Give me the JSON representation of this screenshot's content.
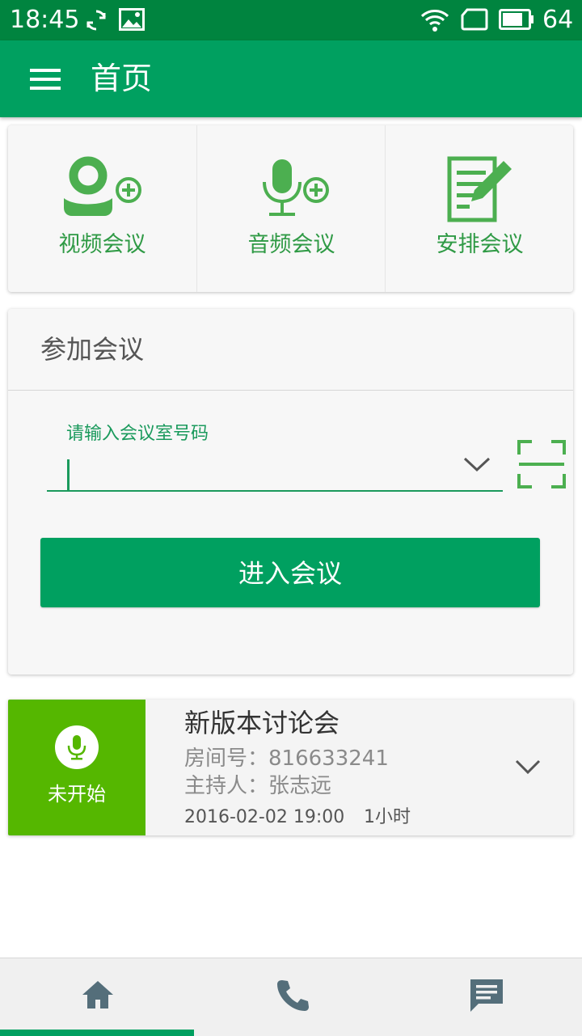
{
  "status_bar": {
    "time": "18:45",
    "battery": "64",
    "icons": [
      "sync-icon",
      "image-icon",
      "wifi-icon",
      "sim-icon",
      "battery-icon"
    ]
  },
  "app_bar": {
    "title": "首页",
    "menu_icon": "menu-icon"
  },
  "quick_actions": [
    {
      "label": "视频会议",
      "icon": "video-conference-add-icon"
    },
    {
      "label": "音频会议",
      "icon": "audio-conference-add-icon"
    },
    {
      "label": "安排会议",
      "icon": "schedule-edit-icon"
    }
  ],
  "join": {
    "heading": "参加会议",
    "input_label": "请输入会议室号码",
    "input_value": "",
    "button_label": "进入会议"
  },
  "meeting": {
    "status": "未开始",
    "title": "新版本讨论会",
    "room_label": "房间号：",
    "room_number": "816633241",
    "host_label": "主持人：",
    "host_name": "张志远",
    "datetime": "2016-02-02 19:00",
    "duration": "1小时"
  },
  "bottom_nav": {
    "tabs": [
      "home-icon",
      "phone-icon",
      "message-icon"
    ],
    "active": 0
  },
  "colors": {
    "status_bar": "#00843f",
    "primary": "#00a060",
    "accent_green": "#2f9a45",
    "status_not_started": "#55b700",
    "nav_icon": "#546e7a"
  }
}
